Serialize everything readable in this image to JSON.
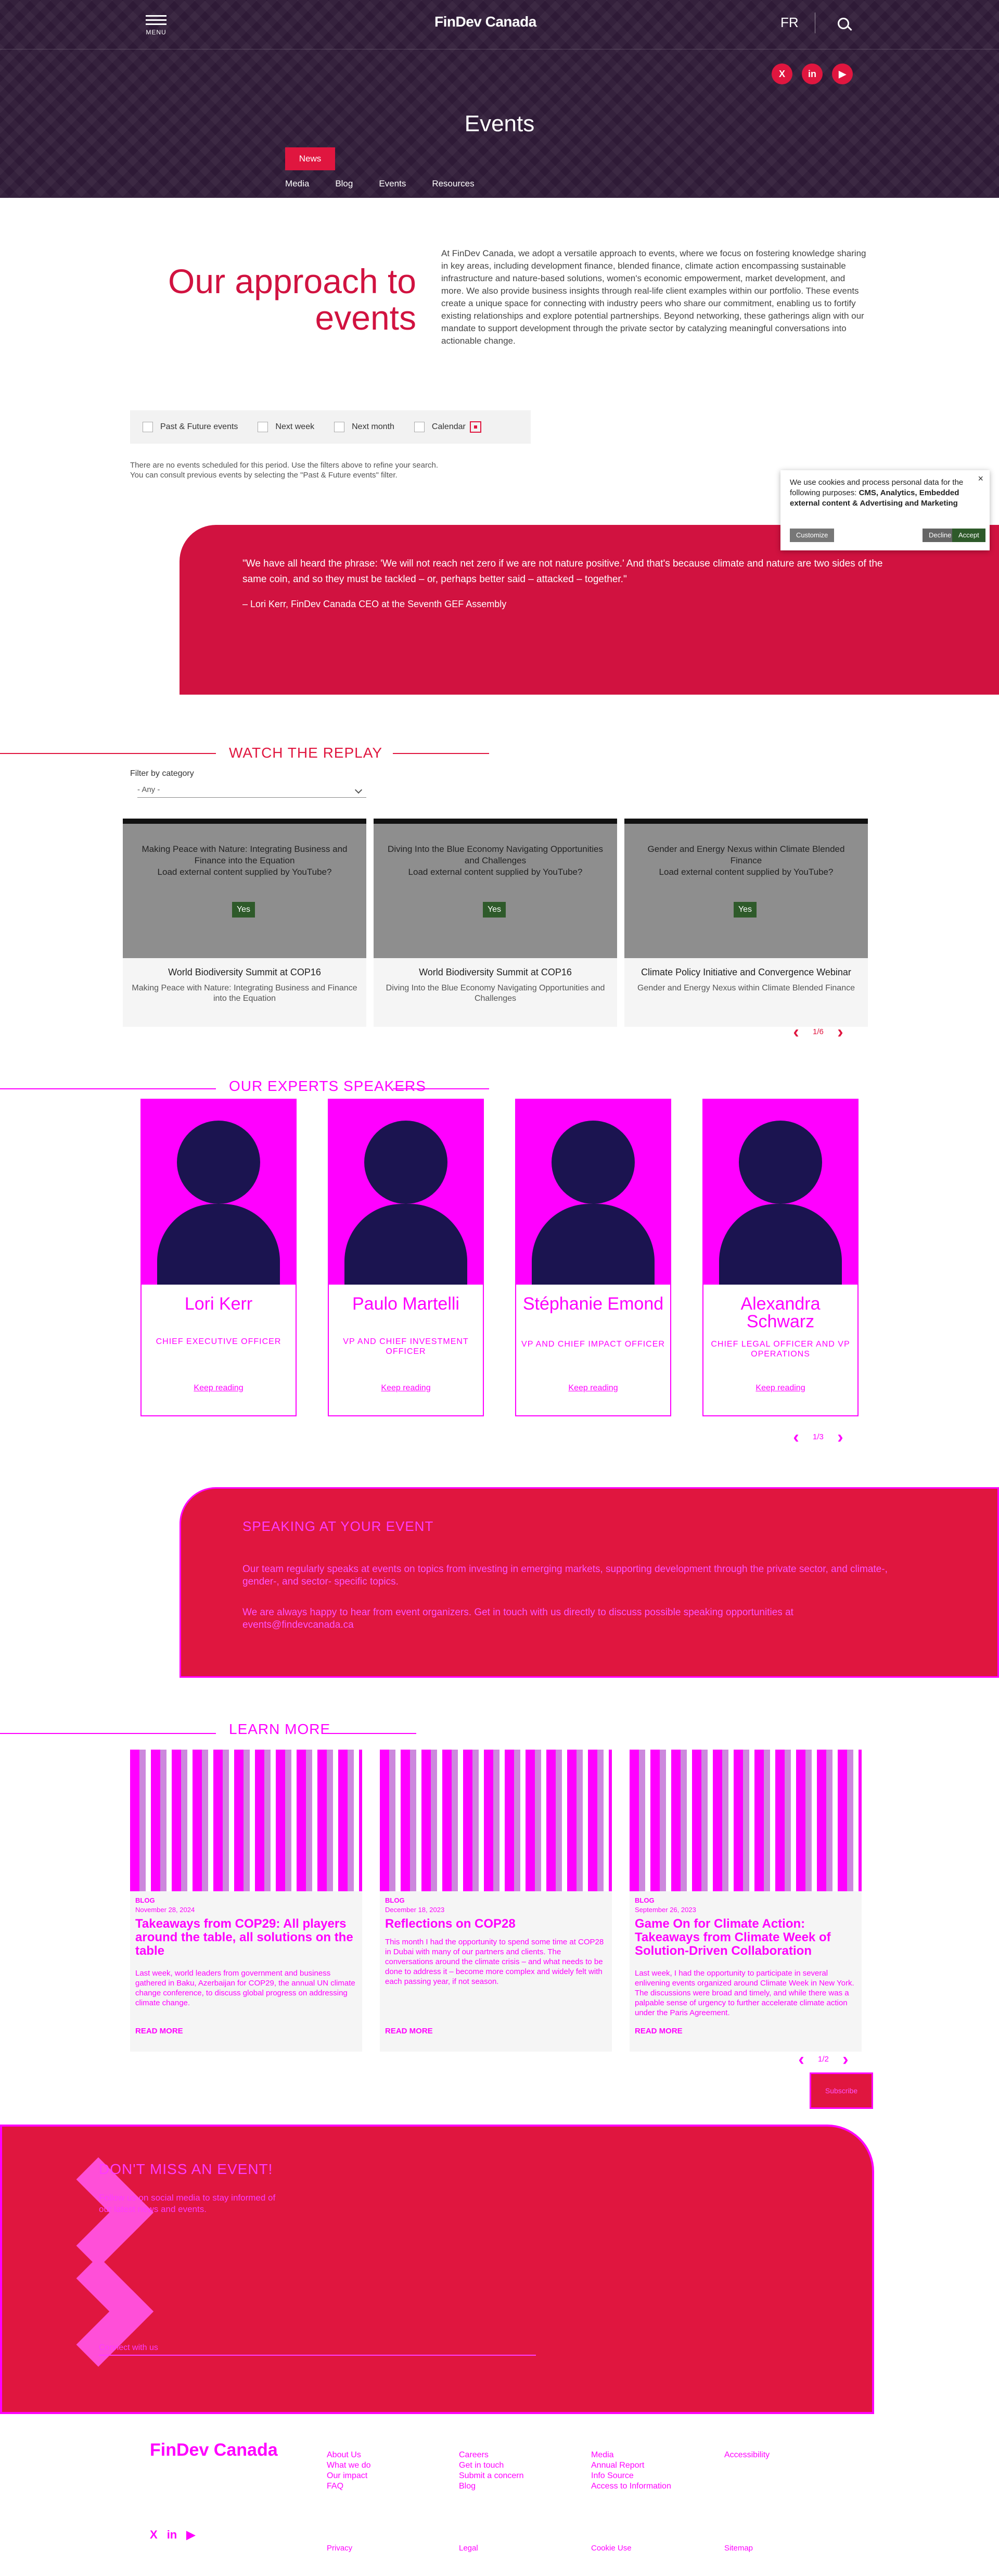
{
  "header": {
    "menu_label": "MENU",
    "logo": "FinDev Canada",
    "lang": "FR",
    "socials": [
      "X",
      "in",
      "▶"
    ],
    "title": "Events",
    "tabs": {
      "active": "News",
      "items": [
        "Media",
        "Blog",
        "Events",
        "Resources"
      ]
    }
  },
  "intro": {
    "title": "Our approach to events",
    "text": "At FinDev Canada, we adopt a versatile approach to events, where we focus on fostering knowledge sharing in key areas, including development finance, blended finance, climate action encompassing sustainable infrastructure and nature-based solutions, women's economic empowerment, market development, and more. We also provide business insights through real-life client examples within our portfolio. These events create a unique space for connecting with industry peers who share our commitment, enabling us to fortify existing relationships and explore potential partnerships. Beyond networking, these gatherings align with our mandate to support development through the private sector by catalyzing meaningful conversations into actionable change."
  },
  "filters": {
    "options": [
      "Past & Future events",
      "Next week",
      "Next month",
      "Calendar"
    ],
    "no_events_1": "There are no events scheduled for this period. Use the filters above to refine your search.",
    "no_events_2": "You can consult previous events by selecting the \"Past & Future events\" filter."
  },
  "cookie": {
    "text_before": "We use cookies and process personal data for the following purposes: ",
    "purposes": "CMS, Analytics, Embedded external content & Advertising and Marketing",
    "customize": "Customize",
    "decline": "Decline",
    "accept": "Accept",
    "close": "×"
  },
  "quote": {
    "text": "\"We have all heard the phrase: 'We will not reach net zero if we are not nature positive.' And that's because climate and nature are two sides of the same coin, and so they must be tackled – or, perhaps better said – attacked – together.\"",
    "by": "– Lori Kerr, FinDev Canada CEO at the Seventh GEF Assembly"
  },
  "replay": {
    "title": "WATCH THE REPLAY",
    "filter_label": "Filter by category",
    "filter_value": "- Any -",
    "videos": [
      {
        "overlay_title": "Making Peace with Nature: Integrating Business and Finance into the Equation",
        "prompt": "Load external content supplied by YouTube?",
        "yes": "Yes",
        "caption": "World Biodiversity Summit at COP16",
        "subtitle": "Making Peace with Nature: Integrating Business and Finance into the Equation"
      },
      {
        "overlay_title": "Diving Into the Blue Economy Navigating Opportunities and Challenges",
        "prompt": "Load external content supplied by YouTube?",
        "yes": "Yes",
        "caption": "World Biodiversity Summit at COP16",
        "subtitle": "Diving Into the Blue Economy Navigating Opportunities and Challenges"
      },
      {
        "overlay_title": "Gender and Energy Nexus within Climate Blended Finance",
        "prompt": "Load external content supplied by YouTube?",
        "yes": "Yes",
        "caption": "Climate Policy Initiative and Convergence Webinar",
        "subtitle": "Gender and Energy Nexus within Climate Blended Finance"
      }
    ],
    "pager": "1/6",
    "prev": "‹",
    "next": "›"
  },
  "speakers": {
    "title": "OUR EXPERTS SPEAKERS",
    "items": [
      {
        "name": "Lori Kerr",
        "role": "CHIEF EXECUTIVE OFFICER",
        "more": "Keep reading"
      },
      {
        "name": "Paulo Martelli",
        "role": "VP AND CHIEF INVESTMENT OFFICER",
        "more": "Keep reading"
      },
      {
        "name": "Stéphanie Emond",
        "role": "VP AND CHIEF IMPACT OFFICER",
        "more": "Keep reading"
      },
      {
        "name": "Alexandra Schwarz",
        "role": "CHIEF LEGAL OFFICER AND VP OPERATIONS",
        "more": "Keep reading"
      }
    ],
    "pager": "1/3",
    "prev": "‹",
    "next": "›"
  },
  "speaking": {
    "title": "SPEAKING AT YOUR EVENT",
    "p1": "Our team regularly speaks at events on topics from investing in emerging markets, supporting development through the private sector, and climate-, gender-, and sector- specific topics.",
    "p2": "We are always happy to hear from event organizers. Get in touch with us directly to discuss possible speaking opportunities at events@findevcanada.ca"
  },
  "learn": {
    "title": "LEARN MORE",
    "cards": [
      {
        "type": "BLOG",
        "date": "November 28, 2024",
        "title": "Takeaways from COP29: All players around the table, all solutions on the table",
        "text": "Last week, world leaders from government and business gathered in Baku, Azerbaijan for COP29, the annual UN climate change conference, to discuss global progress on addressing climate change.",
        "more": "READ MORE"
      },
      {
        "type": "BLOG",
        "date": "December 18, 2023",
        "title": "Reflections on COP28",
        "text": "This month I had the opportunity to spend some time at COP28 in Dubai with many of our partners and clients. The conversations around the climate crisis – and what needs to be done to address it – become more complex and widely felt with each passing year, if not season.",
        "more": "READ MORE"
      },
      {
        "type": "BLOG",
        "date": "September 26, 2023",
        "title": "Game On for Climate Action: Takeaways from Climate Week of Solution-Driven Collaboration",
        "text": "Last week, I had the opportunity to participate in several enlivening events organized around Climate Week in New York. The discussions were broad and timely, and while there was a palpable sense of urgency to further accelerate climate action under the Paris Agreement.",
        "more": "READ MORE"
      }
    ],
    "pager": "1/2",
    "prev": "‹",
    "next": "›",
    "cta": "Subscribe"
  },
  "newsletter": {
    "title": "DON'T MISS AN EVENT!",
    "text": "Follow us on social media to stay informed of our latest news and events.",
    "field": "Connect with us"
  },
  "footer": {
    "logo": "FinDev Canada",
    "col1": [
      "About Us",
      "What we do",
      "Our impact",
      "FAQ"
    ],
    "col2": [
      "Careers",
      "Get in touch",
      "Submit a concern",
      "Blog"
    ],
    "col3": [
      "Media",
      "Annual Report",
      "Info Source",
      "Access to Information"
    ],
    "col4": [
      "Accessibility"
    ],
    "legal": [
      "Privacy",
      "Legal",
      "Cookie Use",
      "Sitemap"
    ],
    "socials": [
      "X",
      "in",
      "▶"
    ]
  },
  "colors": {
    "brand_red": "#e0163f",
    "header_bg": "#2e1a36",
    "glitch_magenta": "#ff00ff"
  }
}
